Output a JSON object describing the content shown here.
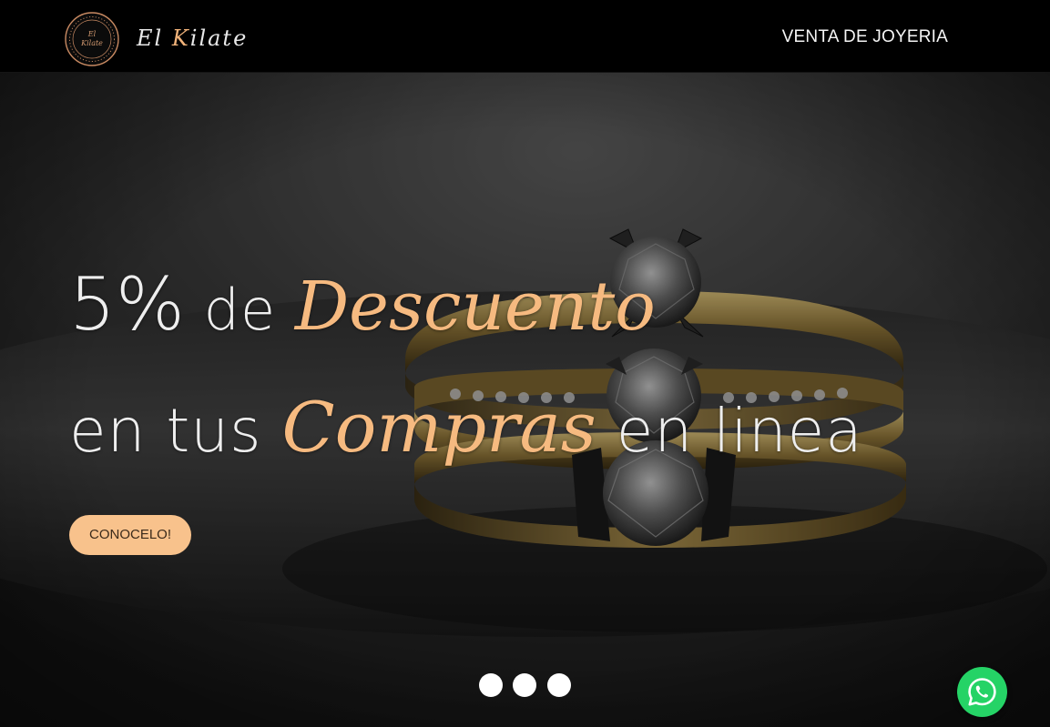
{
  "header": {
    "logo_seal_text_line1": "El",
    "logo_seal_text_line2": "Kilate",
    "brand_part1": "El ",
    "brand_initial": "K",
    "brand_rest": "ilate",
    "nav_label": "VENTA DE JOYERIA"
  },
  "hero": {
    "line1_percent": "5%",
    "line1_mid": " de ",
    "line1_script": "Descuento",
    "line2_start": "en tus ",
    "line2_script": "Compras",
    "line2_end": " en linea",
    "cta_label": "CONOCELO!"
  },
  "carousel": {
    "slide_count": 3
  },
  "icons": {
    "logo": "brand-seal-icon",
    "whatsapp": "whatsapp-icon"
  },
  "colors": {
    "header_bg": "#000000",
    "accent": "#f6ba80",
    "brand_white": "#e6e6e6",
    "cta_bg": "#f8c28c",
    "whatsapp": "#25d366"
  }
}
